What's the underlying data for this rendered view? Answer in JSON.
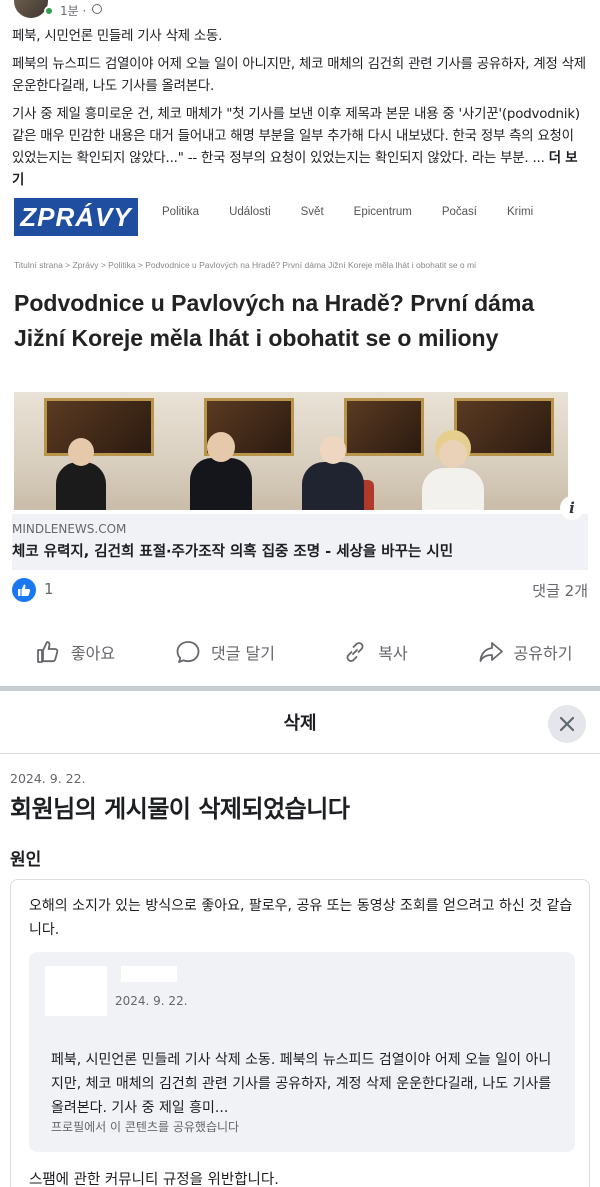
{
  "post": {
    "time": "1분 ·",
    "paragraph1": "페북, 시민언론 민들레 기사 삭제 소동.",
    "paragraph2": "페북의 뉴스피드 검열이야 어제 오늘 일이 아니지만, 체코 매체의 김건희 관련 기사를 공유하자, 계정 삭제 운운한다길래, 나도 기사를 올려본다.",
    "paragraph3": "기사 중 제일 흥미로운 건, 체코 매체가 \"첫 기사를 보낸 이후 제목과 본문 내용 중 '사기꾼'(podvodnik) 같은 매우 민감한 내용은 대거 들어내고 해명 부분을 일부 추가해 다시 내보냈다. 한국 정부 측의 요청이 있었는지는 확인되지 않았다...\" -- 한국 정부의 요청이 있었는지는 확인되지 않았다. 라는 부분. ...",
    "see_more": "더 보기"
  },
  "preview": {
    "logo": "ZPRÁVY",
    "nav": [
      "Politika",
      "Události",
      "Svět",
      "Epicentrum",
      "Počasí",
      "Krimi"
    ],
    "breadcrumb": "Titulní strana > Zprávy > Politika > Podvodnice u Pavlových na Hradě? První dáma Jižní Koreje měla lhát i obohatit se o mi",
    "headline": "Podvodnice u Pavlových na Hradě? První dáma Jižní Koreje měla lhát i obohatit se o miliony",
    "info_icon": "i",
    "domain": "MINDLENEWS.COM",
    "title": "체코 유력지, 김건희 표절·주가조작 의혹 집중 조명 - 세상을 바꾸는 시민"
  },
  "reactions": {
    "like_count": "1",
    "comment_count": "댓글 2개"
  },
  "actions": {
    "like": "좋아요",
    "comment": "댓글 달기",
    "copy": "복사",
    "share": "공유하기"
  },
  "dialog": {
    "title": "삭제",
    "date": "2024. 9. 22.",
    "heading": "회원님의 게시물이 삭제되었습니다",
    "reason_label": "원인",
    "reason_text": "오해의 소지가 있는 방식으로 좋아요, 팔로우, 공유 또는 동영상 조회를 얻으려고 하신 것 같습니다.",
    "quoted_date": "2024. 9. 22.",
    "quoted_text": "페북, 시민언론 민들레 기사 삭제 소동. 페북의 뉴스피드 검열이야 어제 오늘 일이 아니지만, 체코 매체의 김건희 관련 기사를 공유하자, 계정 삭제 운운한다길래, 나도 기사를 올려본다. 기사 중 제일 흥미...",
    "quoted_note": "프로필에서 이 콘텐츠를 공유했습니다",
    "violation": "스팸에 관한 커뮤니티 규정을 위반합니다."
  },
  "colors": {
    "facebook_blue": "#1877f2",
    "zpravy_blue": "#1f4ea0",
    "secondary_text": "#65676b"
  }
}
